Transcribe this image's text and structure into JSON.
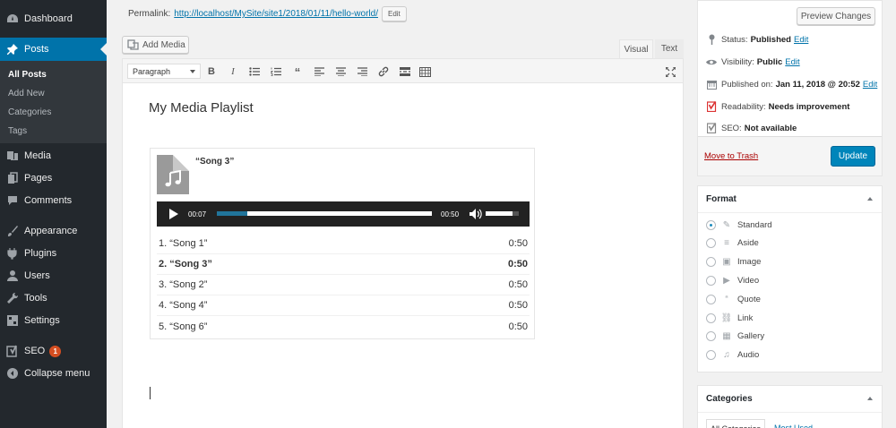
{
  "colors": {
    "admin_bar": "#23282d",
    "accent": "#0073aa",
    "primary_button": "#0085ba",
    "trash": "#a00",
    "badge": "#d54e21"
  },
  "sidebar": {
    "items": [
      {
        "label": "Dashboard",
        "icon": "dashboard-icon"
      },
      {
        "label": "Posts",
        "icon": "pushpin-icon",
        "current": true
      },
      {
        "label": "Media",
        "icon": "media-icon"
      },
      {
        "label": "Pages",
        "icon": "pages-icon"
      },
      {
        "label": "Comments",
        "icon": "comments-icon"
      },
      {
        "label": "Appearance",
        "icon": "appearance-icon"
      },
      {
        "label": "Plugins",
        "icon": "plugins-icon"
      },
      {
        "label": "Users",
        "icon": "users-icon"
      },
      {
        "label": "Tools",
        "icon": "tools-icon"
      },
      {
        "label": "Settings",
        "icon": "settings-icon"
      },
      {
        "label": "SEO",
        "icon": "yoast-icon",
        "badge": "1"
      },
      {
        "label": "Collapse menu",
        "icon": "collapse-icon"
      }
    ],
    "submenu": [
      "All Posts",
      "Add New",
      "Categories",
      "Tags"
    ]
  },
  "editor": {
    "permalink_label": "Permalink:",
    "permalink_url": "http://localhost/MySite/site1/2018/01/11/hello-world/",
    "permalink_edit": "Edit",
    "add_media": "Add Media",
    "tab_visual": "Visual",
    "tab_text": "Text",
    "format_select": "Paragraph",
    "toolbar_buttons": [
      "bold-button",
      "italic-button",
      "bullet-list-button",
      "numbered-list-button",
      "blockquote-button",
      "align-left-button",
      "align-center-button",
      "align-right-button",
      "insert-link-button",
      "read-more-button",
      "toolbar-toggle-button"
    ],
    "post_title": "My Media Playlist"
  },
  "playlist": {
    "current_title": "“Song 3”",
    "player": {
      "elapsed": "00:07",
      "duration": "00:50",
      "progress": 0.14,
      "loaded_start": 0.0,
      "volume": 0.8
    },
    "tracks": [
      {
        "title": "1. “Song 1”",
        "length": "0:50"
      },
      {
        "title": "2. “Song 3”",
        "length": "0:50",
        "active": true
      },
      {
        "title": "3. “Song 2”",
        "length": "0:50"
      },
      {
        "title": "4. “Song 4”",
        "length": "0:50"
      },
      {
        "title": "5. “Song 6”",
        "length": "0:50"
      }
    ]
  },
  "publish": {
    "preview": "Preview Changes",
    "status_label": "Status:",
    "status_value": "Published",
    "visibility_label": "Visibility:",
    "visibility_value": "Public",
    "published_label": "Published on:",
    "published_value": "Jan 11, 2018 @ 20:52",
    "readability_label": "Readability:",
    "readability_value": "Needs improvement",
    "seo_label": "SEO:",
    "seo_value": "Not available",
    "edit": "Edit",
    "trash": "Move to Trash",
    "update": "Update"
  },
  "format_box": {
    "title": "Format",
    "options": [
      {
        "label": "Standard",
        "icon": "pushpin-icon",
        "checked": true
      },
      {
        "label": "Aside",
        "icon": "aside-icon"
      },
      {
        "label": "Image",
        "icon": "image-icon"
      },
      {
        "label": "Video",
        "icon": "video-icon"
      },
      {
        "label": "Quote",
        "icon": "quote-icon"
      },
      {
        "label": "Link",
        "icon": "link-icon"
      },
      {
        "label": "Gallery",
        "icon": "gallery-icon"
      },
      {
        "label": "Audio",
        "icon": "audio-icon"
      }
    ]
  },
  "categories_box": {
    "title": "Categories",
    "tab_all": "All Categories",
    "tab_used": "Most Used"
  }
}
